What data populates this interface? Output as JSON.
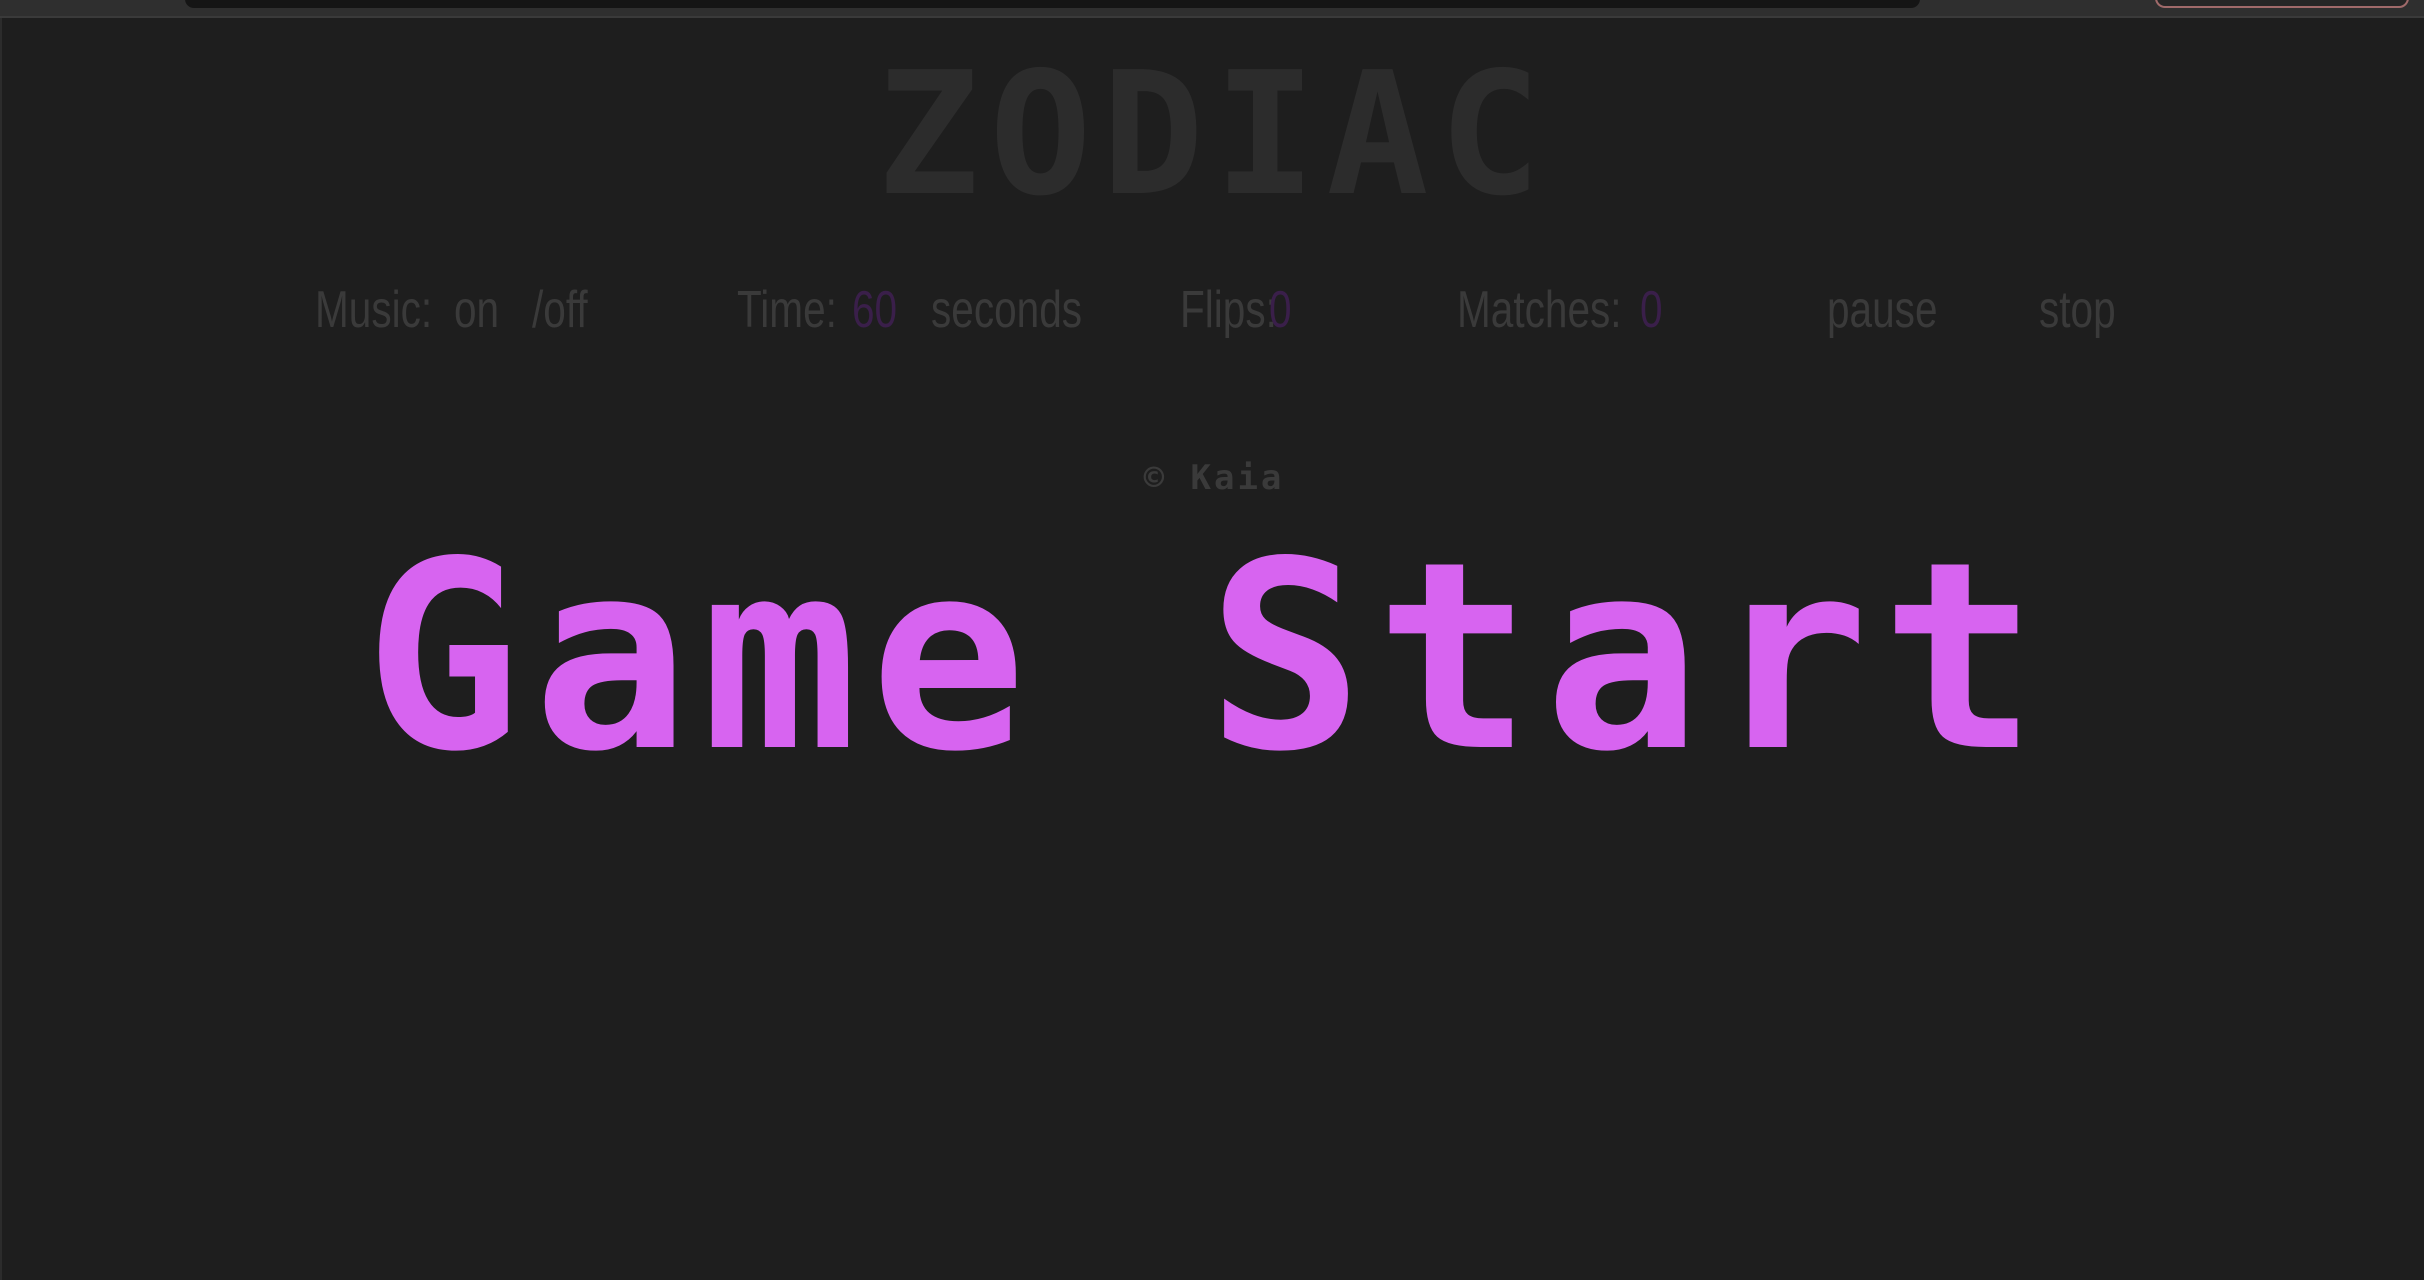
{
  "colors": {
    "background": "#1e1e1e",
    "start_text": "#d764f0",
    "dim_text": "#3a3a3a",
    "dim_number": "#3a1f4a"
  },
  "logo": "ZODIAC",
  "hud": {
    "music_label": "Music:",
    "music_on": "on",
    "music_off": "/off",
    "time_label": "Time:",
    "time_value": "60",
    "time_unit": "seconds",
    "flips_label": "Flips:",
    "flips_value": "0",
    "matches_label": "Matches:",
    "matches_value": "0",
    "pause": "pause",
    "stop": "stop"
  },
  "copyright": "© Kaia",
  "start_label": "Game Start"
}
